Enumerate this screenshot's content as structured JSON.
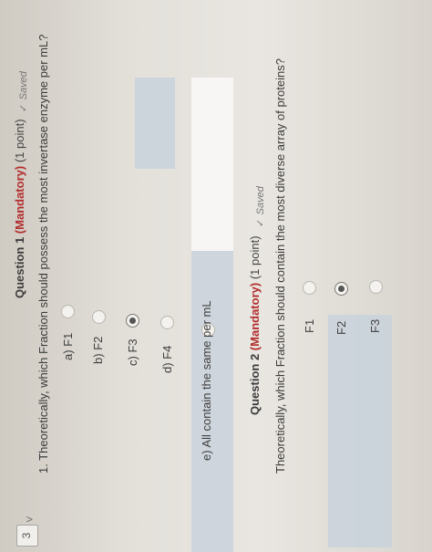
{
  "sidebar": {
    "question_number": "3",
    "chevron": "chevron-down-icon"
  },
  "question1": {
    "title": "Question 1",
    "mandatory": "(Mandatory)",
    "points": "(1 point)",
    "status_check": "✓",
    "status": "Saved",
    "text": "1. Theoretically, which Fraction should possess the most invertase enzyme per mL?",
    "options": [
      {
        "label": "a) F1",
        "selected": false
      },
      {
        "label": "b) F2",
        "selected": false
      },
      {
        "label": "c) F3",
        "selected": true
      },
      {
        "label": "d) F4",
        "selected": false
      },
      {
        "label": "e) All contain the same per mL",
        "selected": false
      }
    ]
  },
  "question2": {
    "title": "Question 2",
    "mandatory": "(Mandatory)",
    "points": "(1 point)",
    "status_check": "✓",
    "status": "Saved",
    "text": "Theoretically, which Fraction should contain the most diverse array of proteins?",
    "options": [
      {
        "label": "F1",
        "selected": false
      },
      {
        "label": "F2",
        "selected": true
      },
      {
        "label": "F3",
        "selected": false
      }
    ]
  },
  "colors": {
    "mandatory": "#b22d2d",
    "highlight": "#c9d2dc"
  }
}
